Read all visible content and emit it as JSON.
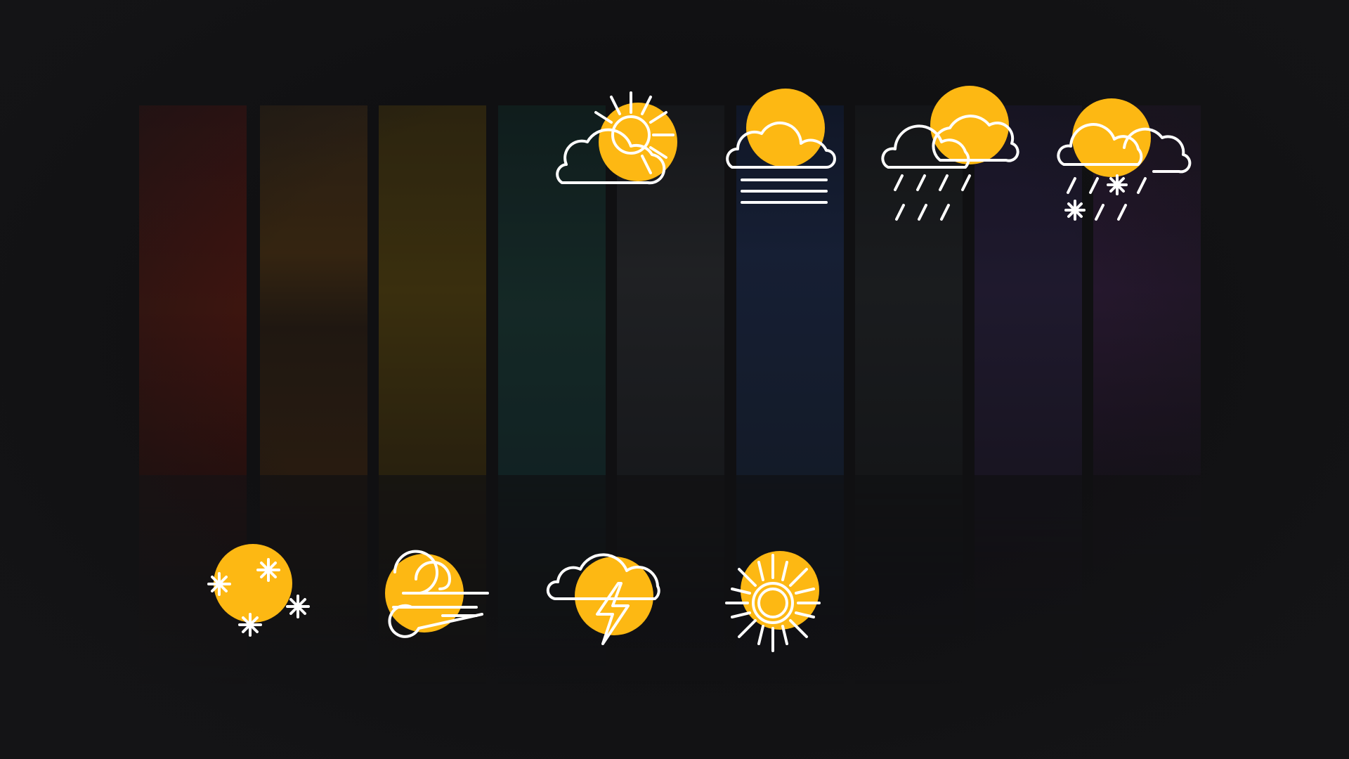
{
  "colors": {
    "background": "#141416",
    "sun_accent": "#FDB813",
    "line_art": "#FFFFFF"
  },
  "photo_strips": [
    {
      "tint": "#4a1512"
    },
    {
      "tint": "#3b2a14"
    },
    {
      "tint": "#4a3a0e"
    },
    {
      "tint": "#17302c"
    },
    {
      "tint": "#222427"
    },
    {
      "tint": "#1a2640"
    },
    {
      "tint": "#1f2224"
    },
    {
      "tint": "#262038"
    },
    {
      "tint": "#2f1c38"
    }
  ],
  "icons": [
    "partly-sunny-icon",
    "fog-icon",
    "rain-icon",
    "sleet-icon",
    "snow-icon",
    "wind-icon",
    "thunderstorm-icon",
    "sunny-icon"
  ]
}
